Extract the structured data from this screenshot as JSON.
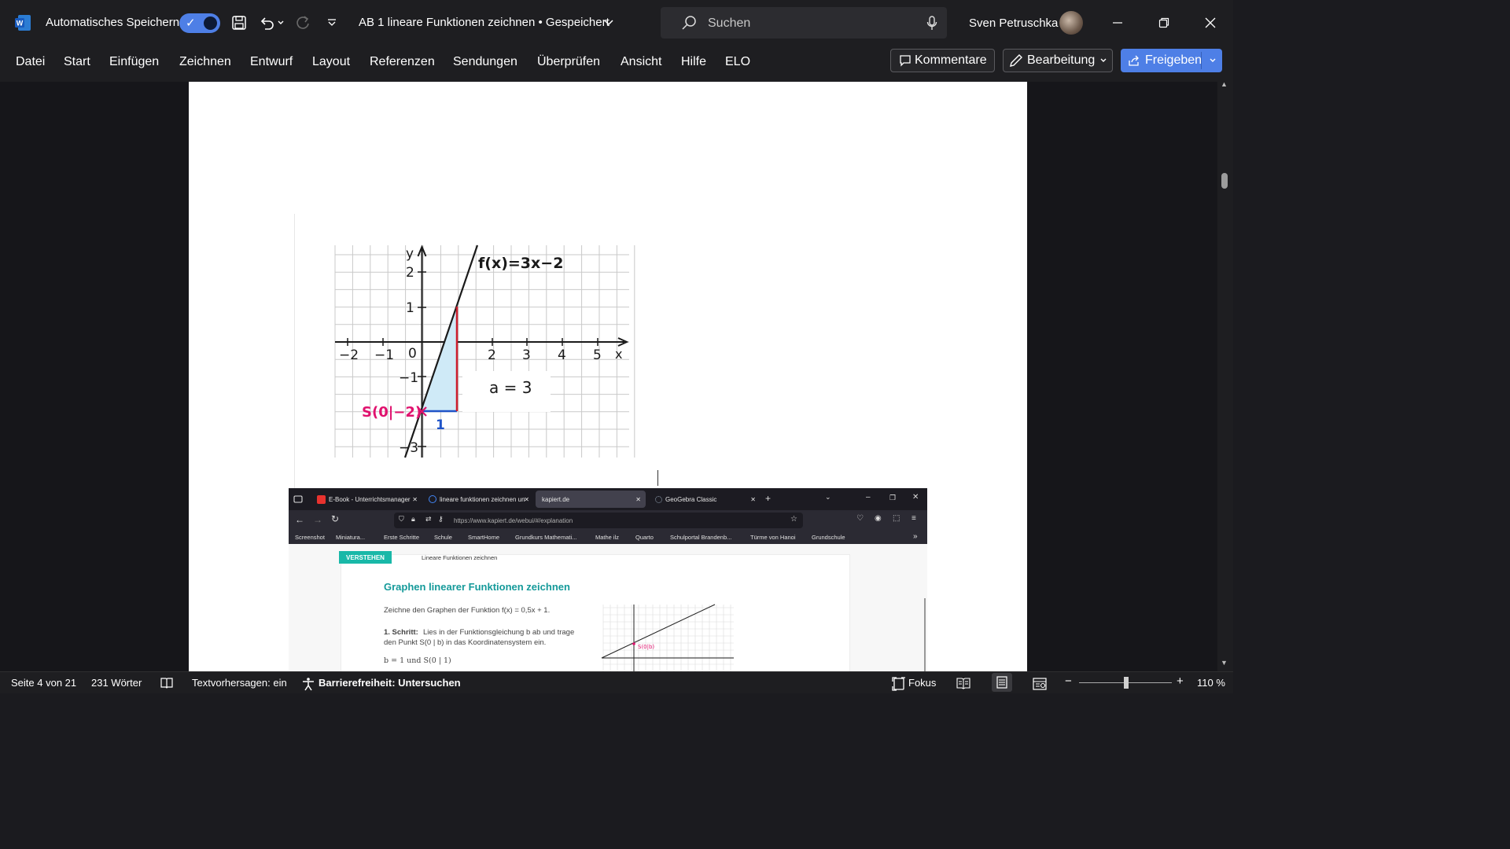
{
  "titlebar": {
    "autosave_label": "Automatisches Speichern",
    "doc_title": "AB 1 lineare Funktionen zeichnen • Gespeichert",
    "search_placeholder": "Suchen",
    "user_name": "Sven Petruschka",
    "accent": "#4e7fe6"
  },
  "ribbon": {
    "tabs": [
      "Datei",
      "Start",
      "Einfügen",
      "Zeichnen",
      "Entwurf",
      "Layout",
      "Referenzen",
      "Sendungen",
      "Überprüfen",
      "Ansicht",
      "Hilfe",
      "ELO"
    ],
    "comments_label": "Kommentare",
    "editing_label": "Bearbeitung",
    "share_label": "Freigeben"
  },
  "figure": {
    "x_axis_label": "x",
    "y_axis_label": "y",
    "x_ticks": [
      "−2",
      "−1",
      "0",
      "2",
      "3",
      "4",
      "5"
    ],
    "y_ticks": [
      "2",
      "1",
      "−1",
      "−3"
    ],
    "function_label": "f(x)=3x−2",
    "point_label": "S(0|−2)",
    "run_label": "1",
    "slope_label": "a = 3"
  },
  "browser": {
    "tabs": [
      "E-Book - Unterrichtsmanager",
      "lineare funktionen zeichnen un",
      "kapiert.de",
      "GeoGebra Classic"
    ],
    "url": "https://www.kapiert.de/webui/#/explanation",
    "bookmarks": [
      "Screenshot",
      "Miniatura...",
      "Erste Schritte",
      "Schule",
      "SmartHome",
      "Grundkurs Mathemati...",
      "Mathe ilz",
      "Quarto",
      "Schulportal Brandenb...",
      "Türme von Hanoi",
      "Grundschule"
    ],
    "badge": "VERSTEHEN",
    "breadcrumb": "Lineare Funktionen zeichnen",
    "heading": "Graphen linearer Funktionen zeichnen",
    "instruction": "Zeichne den Graphen der Funktion f(x) = 0,5x + 1.",
    "step_label": "1. Schritt:",
    "step_text_1": "Lies in der Funktionsgleichung b ab und trage",
    "step_text_2": "den Punkt S(0 | b) in das Koordinatensystem ein.",
    "result": "b = 1 und S(0 | 1)",
    "mini_point_label": "S(0|b)"
  },
  "statusbar": {
    "page": "Seite 4 von 21",
    "words": "231 Wörter",
    "prediction": "Textvorhersagen: ein",
    "accessibility": "Barrierefreiheit: Untersuchen",
    "focus": "Fokus",
    "zoom": "110 %"
  }
}
